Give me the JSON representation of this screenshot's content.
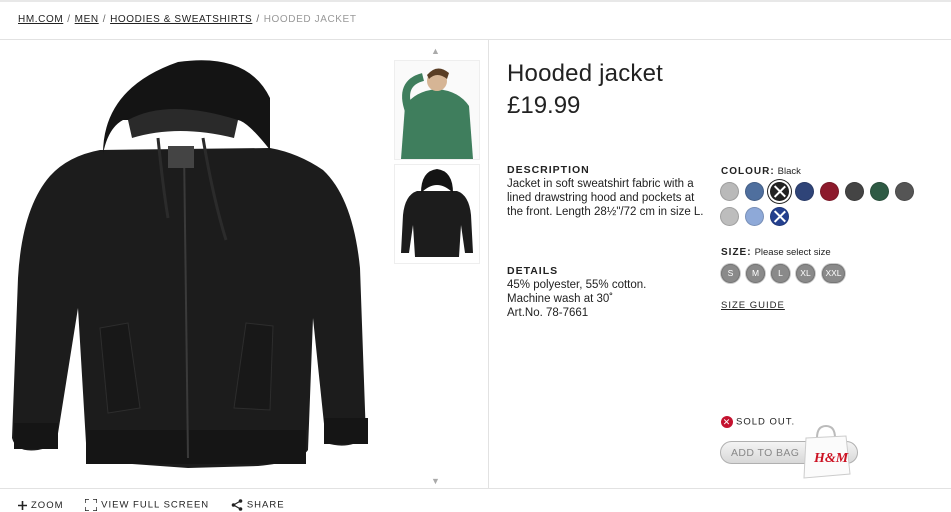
{
  "breadcrumb": {
    "items": [
      "HM.COM",
      "MEN",
      "HOODIES & SWEATSHIRTS"
    ],
    "current": "HOODED JACKET",
    "separator": "/"
  },
  "product": {
    "title": "Hooded jacket",
    "price": "£19.99",
    "description_heading": "DESCRIPTION",
    "description": "Jacket in soft sweatshirt fabric with a lined drawstring hood and pockets at the front. Length 28½\"/72 cm in size L.",
    "details_heading": "DETAILS",
    "details_lines": [
      "45% polyester, 55% cotton.",
      "Machine wash at 30˚",
      "Art.No. 78-7661"
    ]
  },
  "colour": {
    "label": "COLOUR:",
    "selected": "Black",
    "swatches": [
      {
        "color": "#b9b9b9"
      },
      {
        "color": "#4f6f9e"
      },
      {
        "color": "#222222",
        "selected": true,
        "crossed": true
      },
      {
        "color": "#2f4478"
      },
      {
        "color": "#8d1a2c"
      },
      {
        "color": "#444444"
      },
      {
        "color": "#2e5a44"
      },
      {
        "color": "#555555"
      },
      {
        "color": "#bdbdbd"
      },
      {
        "color": "#8ea9d8"
      },
      {
        "color": "#24408f",
        "crossed": true
      }
    ]
  },
  "size": {
    "label": "SIZE:",
    "prompt": "Please select size",
    "options": [
      "S",
      "M",
      "L",
      "XL",
      "XXL"
    ],
    "guide": "SIZE GUIDE"
  },
  "status": {
    "sold_out": "SOLD OUT.",
    "add_to_bag": "ADD TO BAG",
    "bag_logo": "H&M"
  },
  "tools": {
    "zoom": "ZOOM",
    "full_screen": "VIEW FULL SCREEN",
    "share": "SHARE"
  },
  "colors": {
    "accent_red": "#c4122f",
    "text": "#222222"
  }
}
